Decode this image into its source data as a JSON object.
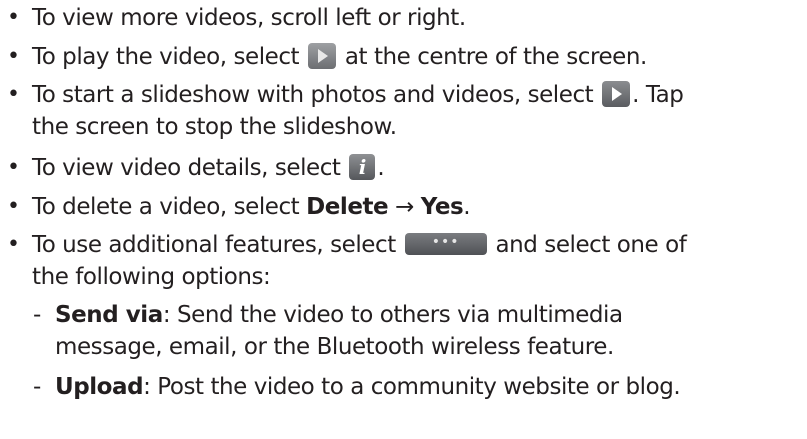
{
  "bullets": [
    {
      "text": "To view more videos, scroll left or right."
    },
    {
      "before": "To play the video, select",
      "icon": "play-icon",
      "after": "at the centre of the screen."
    },
    {
      "before": "To start a slideshow with photos and videos, select",
      "icon": "slideshow-play-icon",
      "after": ". Tap",
      "continuation": "the screen to stop the slideshow."
    },
    {
      "before": "To view video details, select",
      "icon": "info-icon",
      "icon_text": "i",
      "after": "."
    },
    {
      "before": "To delete a video, select",
      "bold1": "Delete",
      "arrow": "→",
      "bold2": "Yes",
      "after": "."
    },
    {
      "before": "To use additional features, select",
      "icon": "more-options-icon",
      "icon_text": "•••",
      "after": "and select one of",
      "continuation": "the following options:"
    }
  ],
  "sub_items": [
    {
      "dash": "-",
      "term": "Send via",
      "desc": ": Send the video to others via multimedia",
      "continuation": "message, email, or the Bluetooth wireless feature."
    },
    {
      "dash": "-",
      "term": "Upload",
      "desc": ": Post the video to a community website or blog."
    }
  ],
  "bullet_glyph": "•",
  "colors": {
    "text": "#231f20",
    "icon_bg": "#6c6e72"
  }
}
